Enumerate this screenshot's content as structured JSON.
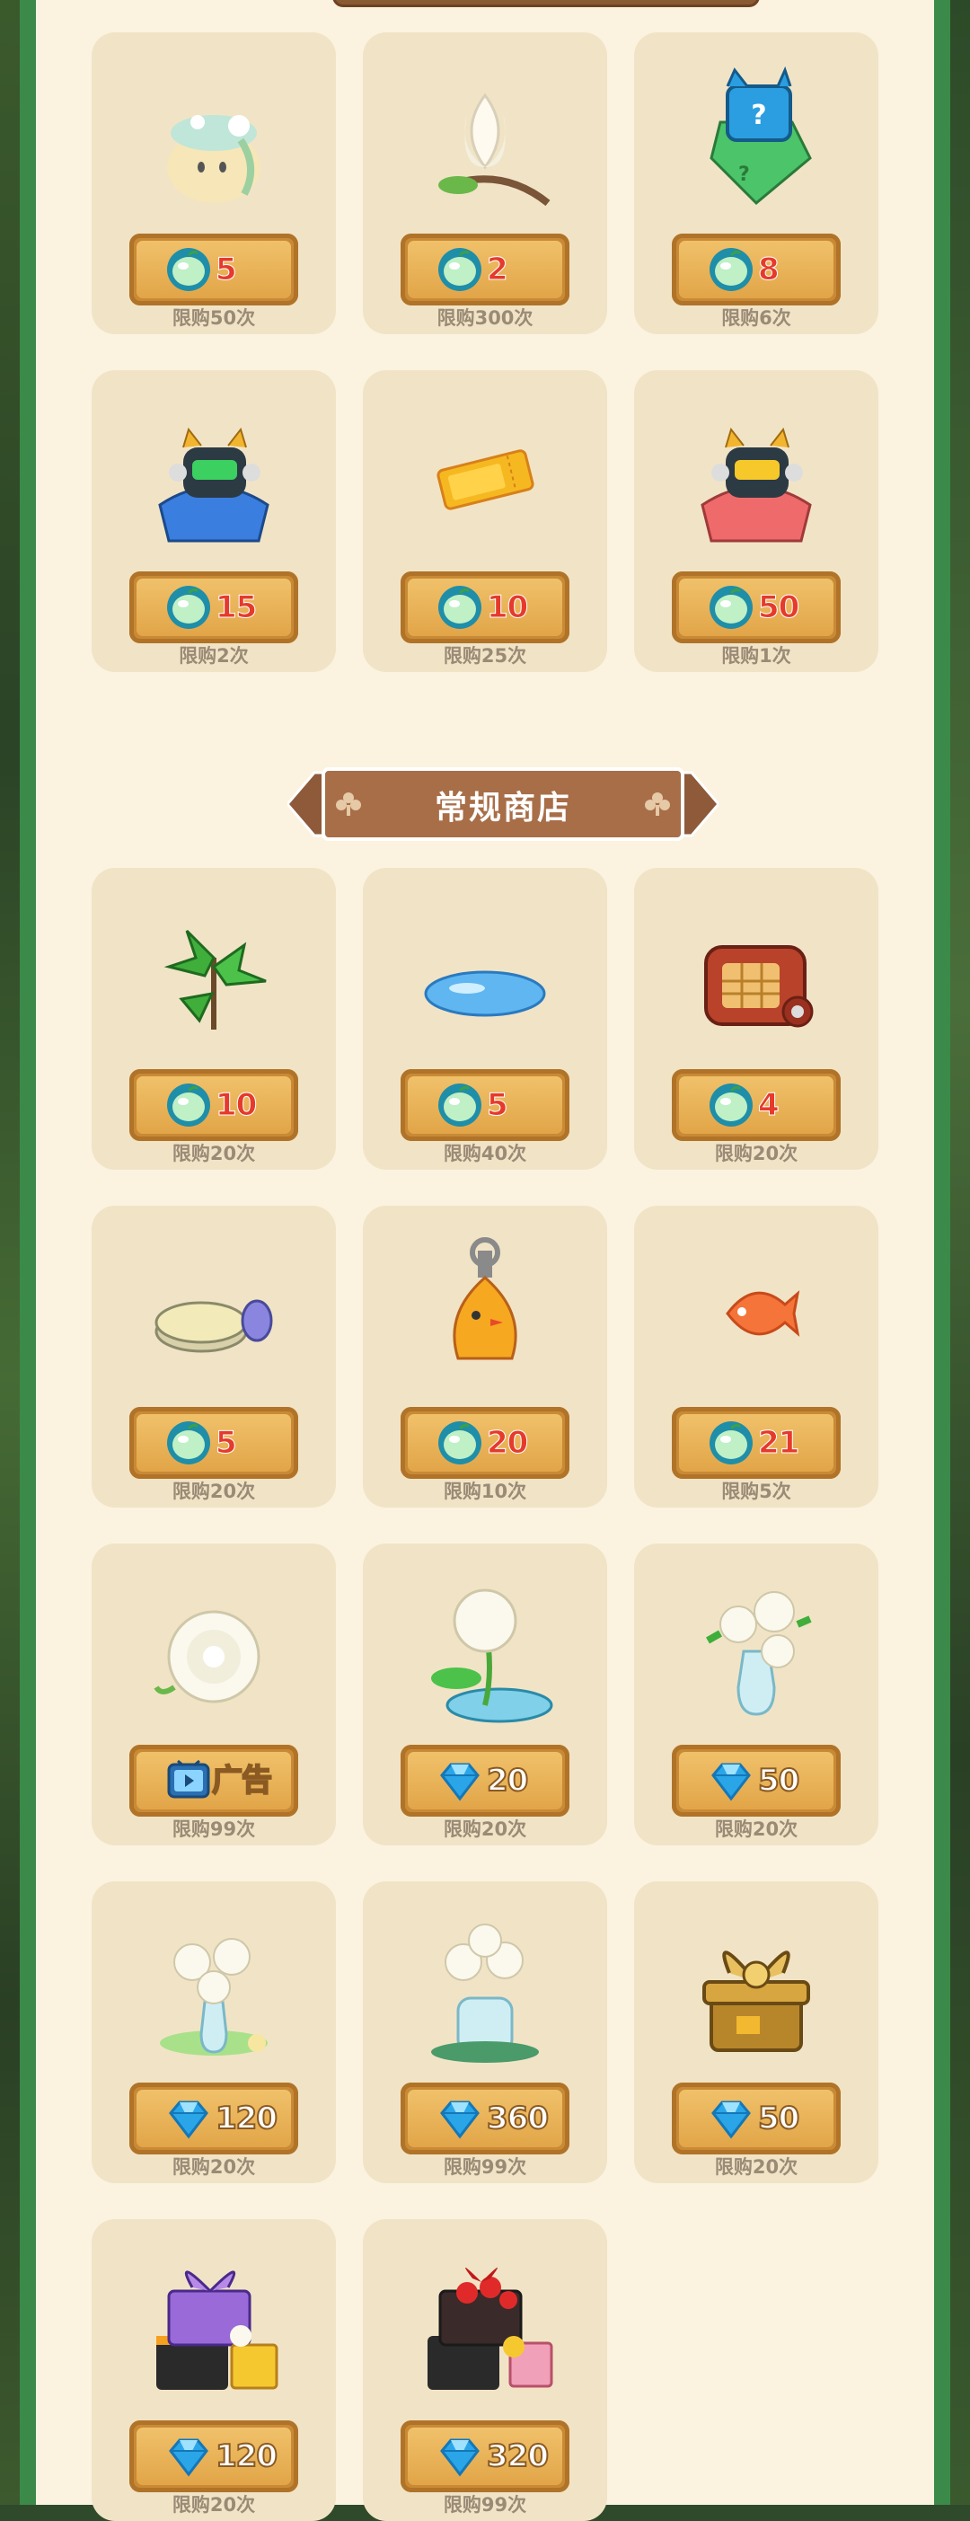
{
  "section_title": "常规商店",
  "limited_rows": [
    [
      {
        "name": "jasmine-bun-pet",
        "price": "5",
        "currency": "seed",
        "limit": "限购50次"
      },
      {
        "name": "magnolia-flower",
        "price": "2",
        "currency": "seed",
        "limit": "限购300次"
      },
      {
        "name": "mystery-cat-bag",
        "price": "8",
        "currency": "seed",
        "limit": "限购6次"
      }
    ],
    [
      {
        "name": "green-robot-cat-bed",
        "price": "15",
        "currency": "seed",
        "limit": "限购2次"
      },
      {
        "name": "gold-ticket",
        "price": "10",
        "currency": "seed",
        "limit": "限购25次"
      },
      {
        "name": "yellow-robot-cat-bed",
        "price": "50",
        "currency": "seed",
        "limit": "限购1次"
      }
    ]
  ],
  "regular_rows": [
    [
      {
        "name": "green-plant",
        "price": "10",
        "currency": "seed",
        "limit": "限购20次"
      },
      {
        "name": "water-drop",
        "price": "5",
        "currency": "seed",
        "limit": "限购40次"
      },
      {
        "name": "radio-box",
        "price": "4",
        "currency": "seed",
        "limit": "限购20次"
      }
    ],
    [
      {
        "name": "cream-tin",
        "price": "5",
        "currency": "seed",
        "limit": "限购20次"
      },
      {
        "name": "windup-chick",
        "price": "20",
        "currency": "seed",
        "limit": "限购10次"
      },
      {
        "name": "orange-fish",
        "price": "21",
        "currency": "seed",
        "limit": "限购5次"
      }
    ],
    [
      {
        "name": "white-gardenia",
        "price": "广告",
        "currency": "ad",
        "limit": "限购99次"
      },
      {
        "name": "gardenia-pond",
        "price": "20",
        "currency": "gem",
        "limit": "限购20次"
      },
      {
        "name": "gardenia-vase",
        "price": "50",
        "currency": "gem",
        "limit": "限购20次"
      }
    ],
    [
      {
        "name": "gardenia-vase-glow",
        "price": "120",
        "currency": "gem",
        "limit": "限购20次"
      },
      {
        "name": "gardenia-jar",
        "price": "360",
        "currency": "gem",
        "limit": "限购99次"
      },
      {
        "name": "gold-gift-box",
        "price": "50",
        "currency": "gem",
        "limit": "限购20次"
      }
    ],
    [
      {
        "name": "purple-gift-set",
        "price": "120",
        "currency": "gem",
        "limit": "限购20次"
      },
      {
        "name": "red-rose-gift-set",
        "price": "320",
        "currency": "gem",
        "limit": "限购99次"
      }
    ]
  ]
}
